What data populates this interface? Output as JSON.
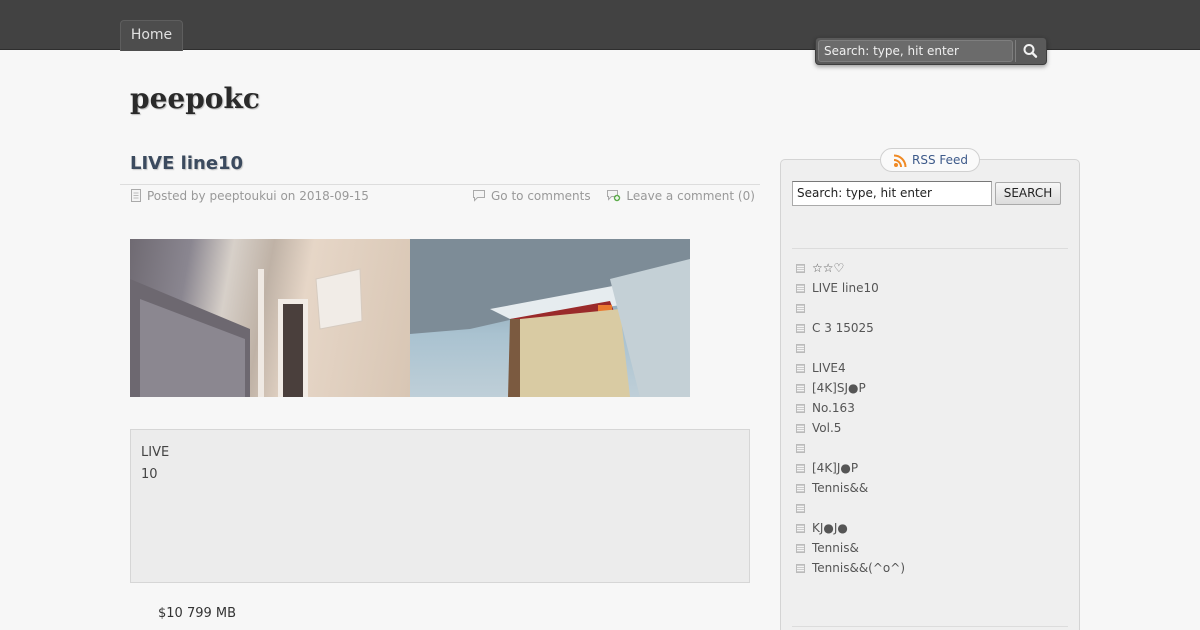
{
  "nav": {
    "home_label": "Home"
  },
  "header_search": {
    "placeholder": "Search: type, hit enter"
  },
  "site": {
    "title": "peepokc"
  },
  "post": {
    "title": "LIVE line10",
    "meta_posted": "Posted by peeptoukui on 2018-09-15",
    "go_to_comments": "Go to comments",
    "leave_comment": "Leave a comment (0)",
    "excerpt_lines": [
      "LIVE",
      "10"
    ],
    "size_line": "$10 799 MB"
  },
  "sidebar": {
    "rss_label": "RSS Feed",
    "search_value": "Search: type, hit enter",
    "search_button": "SEARCH",
    "links": [
      "☆☆♡",
      "LIVE line10",
      "",
      "C 3 15025",
      "",
      "LIVE4",
      "[4K]SJ●P",
      " No.163",
      "Vol.5",
      "",
      "[4K]J●P",
      "Tennis&&",
      "",
      "KJ●J●",
      "Tennis&",
      "Tennis&&(^o^)"
    ]
  },
  "colors": {
    "topbar": "#424242",
    "link": "#3d5a8a",
    "title": "#3b4a5e"
  },
  "icons": [
    "search-icon",
    "document-icon",
    "comment-icon",
    "comment-add-icon",
    "rss-icon"
  ]
}
